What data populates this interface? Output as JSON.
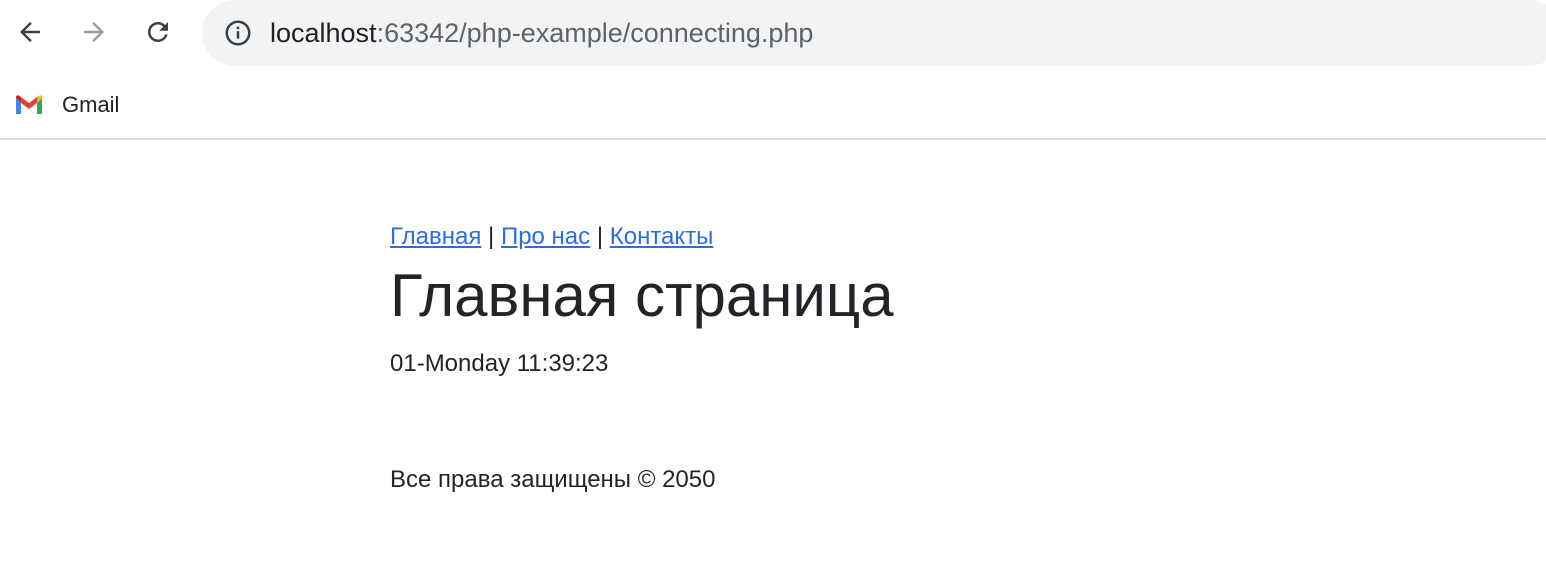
{
  "browser": {
    "icons": {
      "back": "arrow-left-icon",
      "forward": "arrow-right-icon",
      "reload": "reload-icon",
      "site_info": "info-icon",
      "bookmark": "gmail-icon"
    },
    "address": {
      "host": "localhost",
      "rest": ":63342/php-example/connecting.php"
    },
    "bookmarks": [
      {
        "label": "Gmail"
      }
    ]
  },
  "page": {
    "menu": [
      {
        "label": "Главная"
      },
      {
        "label": "Про нас"
      },
      {
        "label": "Контакты"
      }
    ],
    "separator": "|",
    "title": "Главная страница",
    "datetime": "01-Monday 11:39:23",
    "footer": "Все права защищены © 2050"
  },
  "colors": {
    "link": "#2a6fdb",
    "text": "#212529",
    "omnibox_bg": "#f1f3f4"
  }
}
